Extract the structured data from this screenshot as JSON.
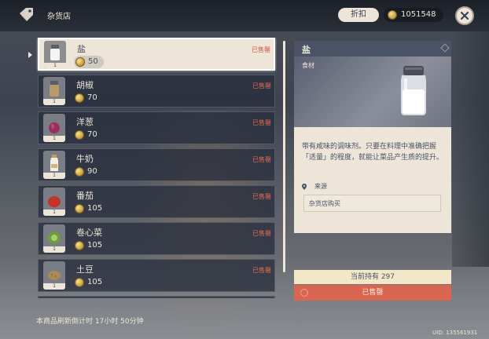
{
  "header": {
    "title": "杂货店",
    "discount_label": "折扣",
    "currency": "1051548"
  },
  "items": [
    {
      "name": "盐",
      "price": "50",
      "count": "1",
      "status": "已售罄",
      "icon": "salt-shaker-icon"
    },
    {
      "name": "胡椒",
      "price": "70",
      "count": "1",
      "status": "已售罄",
      "icon": "pepper-shaker-icon"
    },
    {
      "name": "洋葱",
      "price": "70",
      "count": "1",
      "status": "已售罄",
      "icon": "onion-icon"
    },
    {
      "name": "牛奶",
      "price": "90",
      "count": "1",
      "status": "已售罄",
      "icon": "milk-bottle-icon"
    },
    {
      "name": "番茄",
      "price": "105",
      "count": "1",
      "status": "已售罄",
      "icon": "tomato-icon"
    },
    {
      "name": "卷心菜",
      "price": "105",
      "count": "1",
      "status": "已售罄",
      "icon": "cabbage-icon"
    },
    {
      "name": "土豆",
      "price": "105",
      "count": "1",
      "status": "已售罄",
      "icon": "potato-icon"
    }
  ],
  "refresh_text": "本商品刷新倒计时 17小时 50分钟",
  "detail": {
    "title": "盐",
    "category": "食材",
    "description": "带有咸味的调味剂。只要在料理中准确把握「适量」的程度，就能让菜品产生质的提升。",
    "source_label": "来源",
    "source_value": "杂货店购买",
    "holding": "当前持有 297",
    "sold_out_button": "已售罄"
  },
  "uid": "UID: 135561931",
  "colors": {
    "cream": "#ece5d8",
    "navy": "#4a5366",
    "sold_out_red": "#d96651"
  }
}
